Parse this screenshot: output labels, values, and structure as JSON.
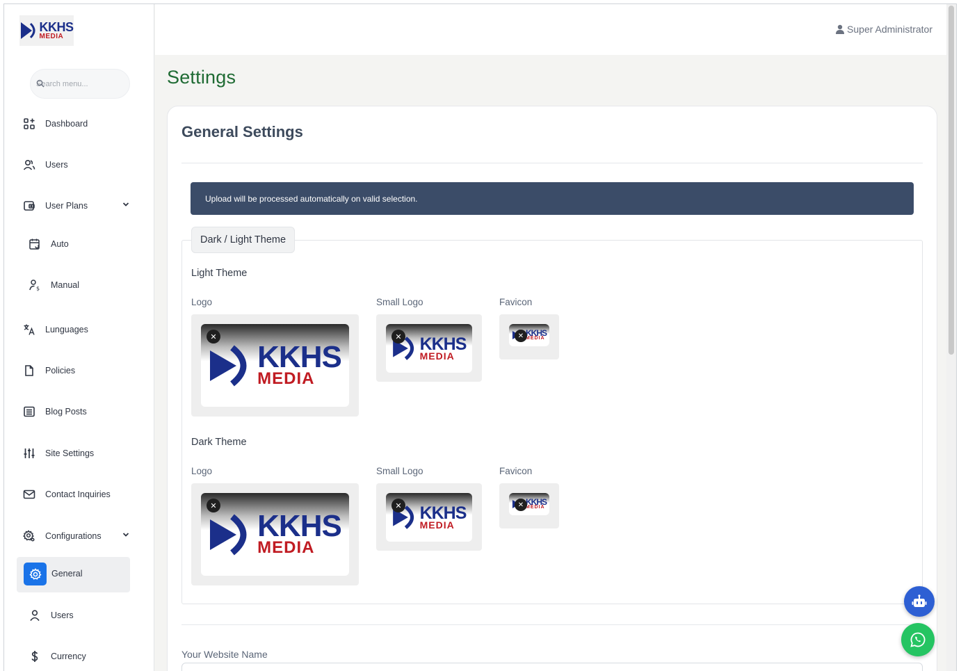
{
  "brand": {
    "name": "KKHS",
    "sub": "MEDIA"
  },
  "search": {
    "placeholder": "Search menu..."
  },
  "sidebar": {
    "items": [
      {
        "label": "Dashboard",
        "icon": "dashboard-icon"
      },
      {
        "label": "Users",
        "icon": "users-icon"
      },
      {
        "label": "User Plans",
        "icon": "wallet-icon"
      },
      {
        "label": "Auto",
        "icon": "calendar-repeat-icon"
      },
      {
        "label": "Manual",
        "icon": "user-dollar-icon"
      },
      {
        "label": "Lunguages",
        "icon": "translate-icon"
      },
      {
        "label": "Policies",
        "icon": "file-icon"
      },
      {
        "label": "Blog Posts",
        "icon": "list-box-icon"
      },
      {
        "label": "Site Settings",
        "icon": "sliders-icon"
      },
      {
        "label": "Contact Inquiries",
        "icon": "mail-icon"
      },
      {
        "label": "Configurations",
        "icon": "gear-icon"
      },
      {
        "label": "General",
        "icon": "gear-icon"
      },
      {
        "label": "Users",
        "icon": "user-icon"
      },
      {
        "label": "Currency",
        "icon": "dollar-icon"
      }
    ]
  },
  "topbar": {
    "user": "Super Administrator"
  },
  "page": {
    "title": "Settings"
  },
  "card": {
    "title": "General Settings",
    "alert": "Upload will be processed automatically on valid selection.",
    "theme_legend": "Dark / Light Theme",
    "light_theme": "Light Theme",
    "dark_theme": "Dark Theme",
    "labels": {
      "logo": "Logo",
      "small_logo": "Small Logo",
      "favicon": "Favicon"
    },
    "website_name_label": "Your Website Name"
  },
  "colors": {
    "accent": "#1a73e8",
    "title_green": "#1f6b34",
    "alert_bg": "#3b4c68",
    "whatsapp": "#25c462",
    "bot": "#2d5fd3"
  }
}
